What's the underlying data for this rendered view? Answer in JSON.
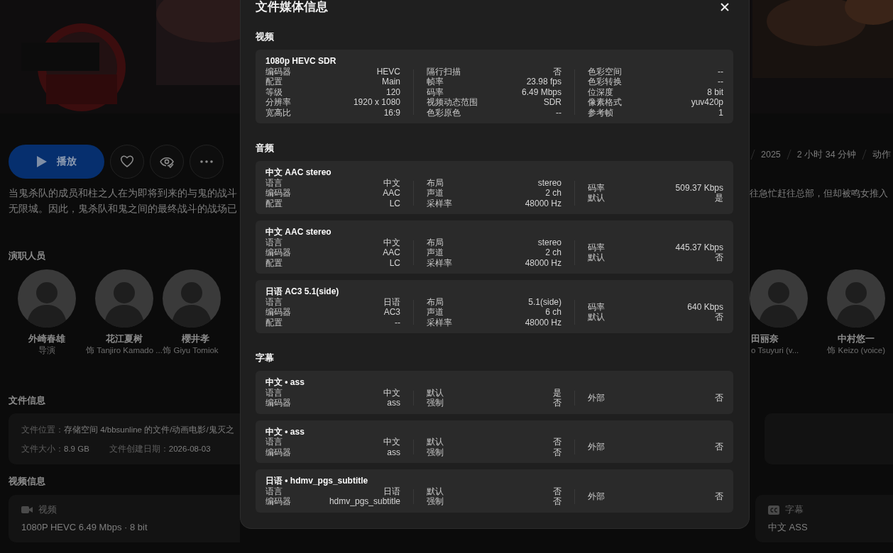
{
  "page": {
    "play_label": "播放",
    "meta": [
      "2025",
      "2 小时 34 分钟",
      "动作"
    ],
    "description_left": [
      "当鬼杀队的成员和柱之人在为即将到来的与鬼的战斗",
      "无限城。因此，鬼杀队和鬼之间的最终战斗的战场已"
    ],
    "description_right": [
      "往急忙赶往总部，但却被鸣女推入"
    ],
    "cast_heading": "演职人员",
    "cast_left": [
      {
        "name": "外崎春雄",
        "role": "导演"
      },
      {
        "name": "花江夏树",
        "role": "饰 Tanjiro Kamado ..."
      },
      {
        "name": "櫻井孝",
        "role": "饰 Giyu Tomiok"
      }
    ],
    "cast_right": [
      {
        "name": "田丽奈",
        "role": "o Tsuyuri (v..."
      },
      {
        "name": "中村悠一",
        "role": "饰 Keizo (voice)"
      }
    ],
    "file_info": {
      "heading": "文件信息",
      "location_label": "文件位置：",
      "location": "存储空间 4/bbsunline 的文件/动画电影/鬼灭之",
      "size_label": "文件大小：",
      "size": "8.9 GB",
      "created_label": "文件创建日期：",
      "created": "2026-08-03"
    },
    "video_info": {
      "heading": "视频信息",
      "cards": [
        {
          "kind": "video",
          "label": "视频",
          "value": "1080P HEVC 6.49 Mbps · 8 bit"
        },
        {
          "kind": "subtitle",
          "label": "字幕",
          "value": "中文 ASS"
        }
      ]
    }
  },
  "dialog": {
    "title": "文件媒体信息",
    "sections": [
      {
        "heading": "视频",
        "tracks": [
          {
            "title": "1080p HEVC SDR",
            "columns": [
              [
                {
                  "label": "编码器",
                  "value": "HEVC"
                },
                {
                  "label": "配置",
                  "value": "Main"
                },
                {
                  "label": "等级",
                  "value": "120"
                },
                {
                  "label": "分辨率",
                  "value": "1920 x 1080"
                },
                {
                  "label": "宽高比",
                  "value": "16:9"
                }
              ],
              [
                {
                  "label": "隔行扫描",
                  "value": "否"
                },
                {
                  "label": "帧率",
                  "value": "23.98 fps"
                },
                {
                  "label": "码率",
                  "value": "6.49 Mbps"
                },
                {
                  "label": "视频动态范围",
                  "value": "SDR"
                },
                {
                  "label": "色彩原色",
                  "value": "--"
                }
              ],
              [
                {
                  "label": "色彩空间",
                  "value": "--"
                },
                {
                  "label": "色彩转换",
                  "value": "--"
                },
                {
                  "label": "位深度",
                  "value": "8 bit"
                },
                {
                  "label": "像素格式",
                  "value": "yuv420p"
                },
                {
                  "label": "参考帧",
                  "value": "1"
                }
              ]
            ]
          }
        ]
      },
      {
        "heading": "音频",
        "tracks": [
          {
            "title": "中文 AAC stereo",
            "columns": [
              [
                {
                  "label": "语言",
                  "value": "中文"
                },
                {
                  "label": "编码器",
                  "value": "AAC"
                },
                {
                  "label": "配置",
                  "value": "LC"
                }
              ],
              [
                {
                  "label": "布局",
                  "value": "stereo"
                },
                {
                  "label": "声道",
                  "value": "2 ch"
                },
                {
                  "label": "采样率",
                  "value": "48000 Hz"
                }
              ],
              [
                {
                  "label": "码率",
                  "value": "509.37 Kbps"
                },
                {
                  "label": "默认",
                  "value": "是"
                }
              ]
            ]
          },
          {
            "title": "中文 AAC stereo",
            "columns": [
              [
                {
                  "label": "语言",
                  "value": "中文"
                },
                {
                  "label": "编码器",
                  "value": "AAC"
                },
                {
                  "label": "配置",
                  "value": "LC"
                }
              ],
              [
                {
                  "label": "布局",
                  "value": "stereo"
                },
                {
                  "label": "声道",
                  "value": "2 ch"
                },
                {
                  "label": "采样率",
                  "value": "48000 Hz"
                }
              ],
              [
                {
                  "label": "码率",
                  "value": "445.37 Kbps"
                },
                {
                  "label": "默认",
                  "value": "否"
                }
              ]
            ]
          },
          {
            "title": "日语 AC3 5.1(side)",
            "columns": [
              [
                {
                  "label": "语言",
                  "value": "日语"
                },
                {
                  "label": "编码器",
                  "value": "AC3"
                },
                {
                  "label": "配置",
                  "value": "--"
                }
              ],
              [
                {
                  "label": "布局",
                  "value": "5.1(side)"
                },
                {
                  "label": "声道",
                  "value": "6 ch"
                },
                {
                  "label": "采样率",
                  "value": "48000 Hz"
                }
              ],
              [
                {
                  "label": "码率",
                  "value": "640 Kbps"
                },
                {
                  "label": "默认",
                  "value": "否"
                }
              ]
            ]
          }
        ]
      },
      {
        "heading": "字幕",
        "tracks": [
          {
            "title": "中文 • ass",
            "columns": [
              [
                {
                  "label": "语言",
                  "value": "中文"
                },
                {
                  "label": "编码器",
                  "value": "ass"
                }
              ],
              [
                {
                  "label": "默认",
                  "value": "是"
                },
                {
                  "label": "强制",
                  "value": "否"
                }
              ],
              [
                {
                  "label": "外部",
                  "value": "否"
                }
              ]
            ]
          },
          {
            "title": "中文 • ass",
            "columns": [
              [
                {
                  "label": "语言",
                  "value": "中文"
                },
                {
                  "label": "编码器",
                  "value": "ass"
                }
              ],
              [
                {
                  "label": "默认",
                  "value": "否"
                },
                {
                  "label": "强制",
                  "value": "否"
                }
              ],
              [
                {
                  "label": "外部",
                  "value": "否"
                }
              ]
            ]
          },
          {
            "title": "日语 • hdmv_pgs_subtitle",
            "columns": [
              [
                {
                  "label": "语言",
                  "value": "日语"
                },
                {
                  "label": "编码器",
                  "value": "hdmv_pgs_subtitle"
                }
              ],
              [
                {
                  "label": "默认",
                  "value": "否"
                },
                {
                  "label": "强制",
                  "value": "否"
                }
              ],
              [
                {
                  "label": "外部",
                  "value": "否"
                }
              ]
            ]
          }
        ]
      }
    ]
  }
}
